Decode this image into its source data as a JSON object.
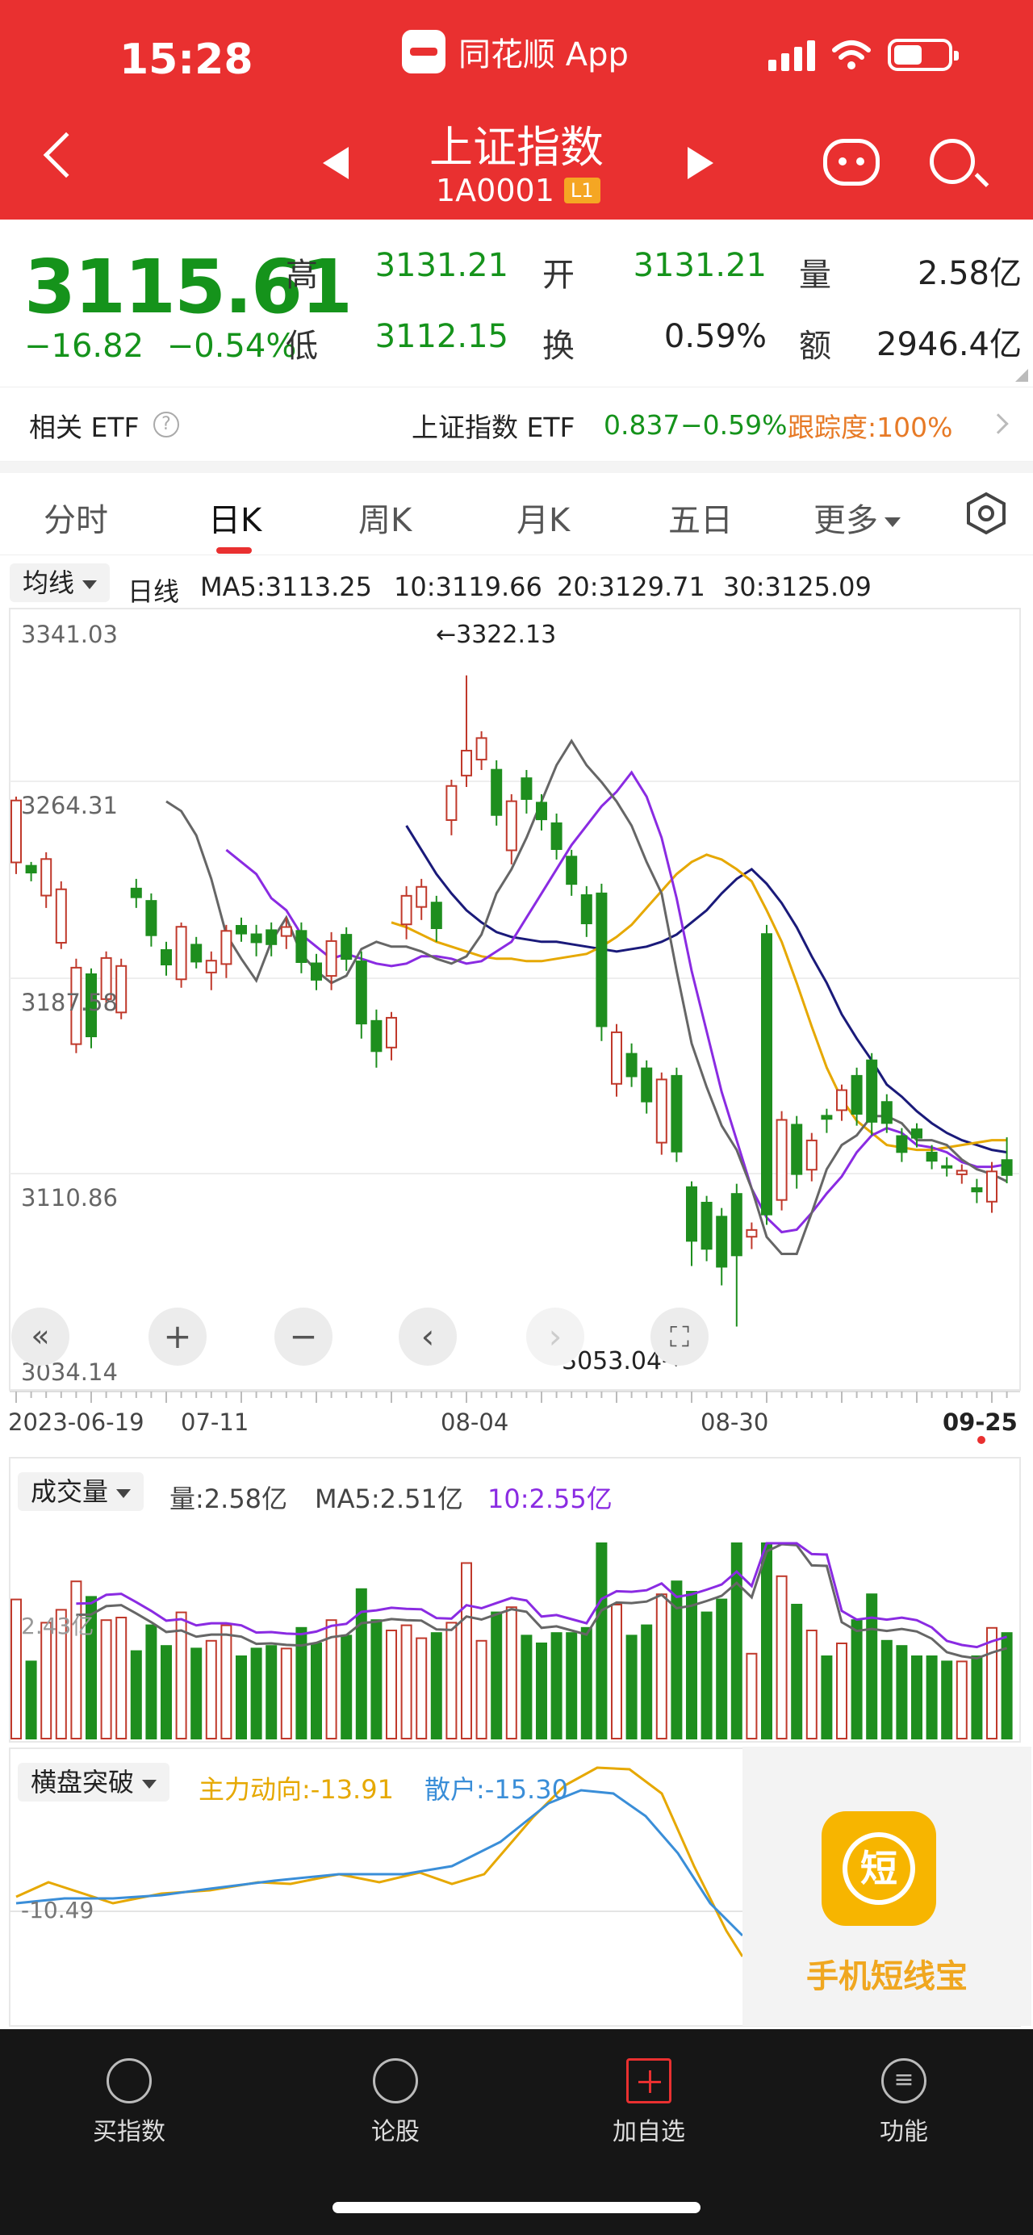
{
  "status_bar": {
    "time": "15:28",
    "app_name": "同花顺 App"
  },
  "header": {
    "title": "上证指数",
    "code": "1A0001",
    "level_badge": "L1"
  },
  "quote": {
    "price": "3115.61",
    "change": "−16.82",
    "change_pct": "−0.54%",
    "fields": [
      {
        "label": "高",
        "value": "3131.21",
        "color": "#15931b"
      },
      {
        "label": "开",
        "value": "3131.21",
        "color": "#15931b"
      },
      {
        "label": "量",
        "value": "2.58亿",
        "color": "#222222"
      },
      {
        "label": "低",
        "value": "3112.15",
        "color": "#15931b"
      },
      {
        "label": "换",
        "value": "0.59%",
        "color": "#222222"
      },
      {
        "label": "额",
        "value": "2946.4亿",
        "color": "#222222"
      }
    ]
  },
  "etf": {
    "label": "相关 ETF",
    "name": "上证指数 ETF",
    "price": "0.837",
    "pct": "−0.59%",
    "tracking": "跟踪度:100%"
  },
  "tabs": [
    "分时",
    "日K",
    "周K",
    "月K",
    "五日",
    "更多"
  ],
  "active_tab": "日K",
  "ma_legend": {
    "selector": "均线",
    "period": "日线",
    "items": [
      {
        "text": "MA5:3113.25",
        "color": "#444444"
      },
      {
        "text": "10:3119.66",
        "color": "#8a2be2"
      },
      {
        "text": "20:3129.71",
        "color": "#e6a800"
      },
      {
        "text": "30:3125.09",
        "color": "#1a1a7a"
      }
    ]
  },
  "kline": {
    "y_labels": [
      "3341.03",
      "3264.31",
      "3187.58",
      "3110.86",
      "3034.14"
    ],
    "x_labels": [
      "2023-06-19",
      "07-11",
      "08-04",
      "08-30",
      "09-25"
    ],
    "high_annotation": "←3322.13",
    "low_annotation": "3053.04→",
    "controls": [
      "«",
      "+",
      "−",
      "‹",
      "›",
      "⛶"
    ]
  },
  "volume": {
    "selector": "成交量",
    "items": [
      {
        "text": "量:2.58亿",
        "color": "#444444"
      },
      {
        "text": "MA5:2.51亿",
        "color": "#444444"
      },
      {
        "text": "10:2.55亿",
        "color": "#8a2be2"
      }
    ],
    "axis_label": "2.43亿"
  },
  "indicator": {
    "selector": "横盘突破",
    "items": [
      {
        "text": "主力动向:-13.91",
        "color": "#e6a800"
      },
      {
        "text": "散户:-15.30",
        "color": "#3a8ed8"
      }
    ],
    "axis_label": "-10.49"
  },
  "ad": {
    "icon_char": "短",
    "title": "手机短线宝"
  },
  "bottom_nav": [
    {
      "label": "买指数",
      "icon": "buy-index-icon"
    },
    {
      "label": "论股",
      "icon": "discuss-icon"
    },
    {
      "label": "加自选",
      "icon": "add-watchlist-icon"
    },
    {
      "label": "功能",
      "icon": "menu-icon"
    }
  ],
  "chart_data": {
    "type": "candlestick",
    "ylim": [
      3034.14,
      3341.03
    ],
    "candles": [
      [
        3244.8,
        3270.4,
        3240.0,
        3272.0
      ],
      [
        3243.4,
        3240.6,
        3237.0,
        3245.0
      ],
      [
        3231.1,
        3246.2,
        3226.0,
        3249.0
      ],
      [
        3211.6,
        3233.7,
        3209.0,
        3237.0
      ],
      [
        3169.7,
        3201.3,
        3166.0,
        3205.0
      ],
      [
        3198.6,
        3172.9,
        3168.0,
        3201.0
      ],
      [
        3188.3,
        3205.3,
        3184.0,
        3208.0
      ],
      [
        3182.8,
        3202.0,
        3180.0,
        3205.0
      ],
      [
        3234.0,
        3230.4,
        3226.0,
        3238.0
      ],
      [
        3228.9,
        3214.7,
        3210.0,
        3232.0
      ],
      [
        3208.6,
        3202.6,
        3198.0,
        3212.0
      ],
      [
        3196.5,
        3218.2,
        3193.0,
        3220.0
      ],
      [
        3210.8,
        3203.8,
        3201.0,
        3214.0
      ],
      [
        3199.3,
        3204.2,
        3192.0,
        3208.0
      ],
      [
        3202.8,
        3216.5,
        3197.0,
        3219.0
      ],
      [
        3218.6,
        3215.4,
        3212.0,
        3222.0
      ],
      [
        3215.1,
        3211.8,
        3206.0,
        3219.0
      ],
      [
        3216.8,
        3211.0,
        3206.0,
        3220.0
      ],
      [
        3214.4,
        3218.1,
        3209.0,
        3222.0
      ],
      [
        3216.5,
        3203.6,
        3199.0,
        3220.0
      ],
      [
        3203.1,
        3196.3,
        3192.0,
        3207.0
      ],
      [
        3197.9,
        3212.3,
        3192.0,
        3216.0
      ],
      [
        3214.9,
        3204.9,
        3200.0,
        3218.0
      ],
      [
        3203.9,
        3178.2,
        3172.0,
        3208.0
      ],
      [
        3179.3,
        3166.8,
        3160.0,
        3184.0
      ],
      [
        3168.3,
        3180.6,
        3163.0,
        3183.0
      ],
      [
        3219.2,
        3231.0,
        3213.0,
        3235.0
      ],
      [
        3226.4,
        3234.7,
        3221.0,
        3238.0
      ],
      [
        3228.2,
        3217.6,
        3212.0,
        3231.0
      ],
      [
        3262.3,
        3276.4,
        3256.0,
        3279.0
      ],
      [
        3280.7,
        3291.0,
        3276.0,
        3322.1
      ],
      [
        3287.3,
        3296.2,
        3283.0,
        3299.0
      ],
      [
        3283.1,
        3264.4,
        3260.0,
        3287.0
      ],
      [
        3249.8,
        3270.1,
        3244.0,
        3273.0
      ],
      [
        3279.6,
        3271.0,
        3265.0,
        3283.0
      ],
      [
        3269.5,
        3262.6,
        3258.0,
        3273.0
      ],
      [
        3261.0,
        3250.3,
        3246.0,
        3265.0
      ],
      [
        3247.2,
        3235.9,
        3231.0,
        3250.0
      ],
      [
        3231.3,
        3219.6,
        3214.0,
        3235.0
      ],
      [
        3232.0,
        3177.1,
        3171.0,
        3236.0
      ],
      [
        3153.3,
        3174.6,
        3148.0,
        3178.0
      ],
      [
        3165.7,
        3156.4,
        3152.0,
        3170.0
      ],
      [
        3159.7,
        3146.0,
        3141.0,
        3163.0
      ],
      [
        3129.0,
        3155.1,
        3124.0,
        3158.0
      ],
      [
        3156.6,
        3125.3,
        3121.0,
        3160.0
      ],
      [
        3110.6,
        3088.4,
        3078.0,
        3113.0
      ],
      [
        3104.2,
        3085.1,
        3080.0,
        3107.0
      ],
      [
        3098.4,
        3077.7,
        3070.0,
        3102.0
      ],
      [
        3107.8,
        3082.4,
        3053.0,
        3112.0
      ],
      [
        3090.1,
        3092.9,
        3085.0,
        3096.0
      ],
      [
        3215.2,
        3099.3,
        3095.0,
        3219.0
      ],
      [
        3105.3,
        3138.4,
        3101.0,
        3142.0
      ],
      [
        3136.4,
        3116.0,
        3110.0,
        3140.0
      ],
      [
        3117.8,
        3129.9,
        3113.0,
        3133.0
      ],
      [
        3140.1,
        3138.8,
        3133.0,
        3143.0
      ],
      [
        3142.4,
        3150.7,
        3138.0,
        3153.0
      ],
      [
        3156.6,
        3140.9,
        3136.0,
        3160.0
      ],
      [
        3163.0,
        3137.6,
        3132.0,
        3166.0
      ],
      [
        3145.8,
        3137.1,
        3133.0,
        3149.0
      ],
      [
        3131.7,
        3125.1,
        3121.0,
        3135.0
      ],
      [
        3134.5,
        3131.0,
        3127.0,
        3137.0
      ],
      [
        3124.9,
        3121.5,
        3118.0,
        3128.0
      ],
      [
        3119.3,
        3118.9,
        3115.0,
        3123.0
      ],
      [
        3115.9,
        3117.4,
        3112.0,
        3120.0
      ],
      [
        3110.2,
        3108.8,
        3104.0,
        3114.0
      ],
      [
        3104.6,
        3117.1,
        3100.0,
        3121.0
      ],
      [
        3121.8,
        3115.6,
        3112.2,
        3131.2
      ]
    ],
    "ma5": [
      3270,
      3266,
      3256,
      3238,
      3215,
      3205,
      3196,
      3212,
      3222,
      3207,
      3200,
      3195,
      3198,
      3209,
      3212,
      3210,
      3210,
      3208,
      3205,
      3203,
      3206,
      3215,
      3232,
      3242,
      3255,
      3270,
      3285,
      3295,
      3285,
      3278,
      3270,
      3260,
      3245,
      3232,
      3200,
      3170,
      3152,
      3136,
      3126,
      3110,
      3090,
      3083,
      3083,
      3100,
      3118,
      3128,
      3132,
      3140,
      3140,
      3137,
      3130,
      3130,
      3128,
      3122,
      3118,
      3116,
      3113
    ],
    "ma10": [
      3250,
      3245,
      3240,
      3230,
      3225,
      3215,
      3210,
      3205,
      3207,
      3205,
      3203,
      3202,
      3203,
      3206,
      3206,
      3205,
      3203,
      3204,
      3208,
      3212,
      3222,
      3232,
      3242,
      3252,
      3260,
      3268,
      3274,
      3282,
      3272,
      3255,
      3230,
      3200,
      3175,
      3150,
      3130,
      3110,
      3098,
      3092,
      3093,
      3100,
      3108,
      3115,
      3125,
      3132,
      3135,
      3133,
      3128,
      3127,
      3125,
      3121,
      3119,
      3119,
      3120
    ],
    "ma20": [
      3220,
      3218,
      3215,
      3212,
      3210,
      3208,
      3206,
      3205,
      3205,
      3204,
      3204,
      3205,
      3206,
      3207,
      3210,
      3214,
      3219,
      3226,
      3233,
      3240,
      3245,
      3248,
      3246,
      3242,
      3237,
      3225,
      3212,
      3195,
      3177,
      3160,
      3147,
      3138,
      3133,
      3128,
      3127,
      3126,
      3126,
      3127,
      3128,
      3129,
      3130,
      3130
    ],
    "ma30": [
      3260,
      3250,
      3240,
      3232,
      3225,
      3220,
      3216,
      3214,
      3213,
      3212,
      3212,
      3211,
      3210,
      3209,
      3208,
      3209,
      3210,
      3212,
      3215,
      3220,
      3225,
      3232,
      3238,
      3242,
      3236,
      3228,
      3218,
      3206,
      3195,
      3182,
      3172,
      3163,
      3153,
      3148,
      3142,
      3137,
      3133,
      3130,
      3128,
      3126,
      3125
    ]
  }
}
